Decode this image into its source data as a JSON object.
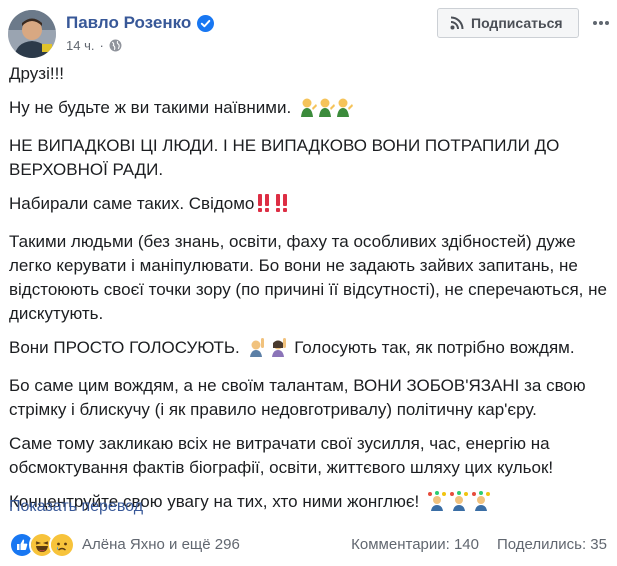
{
  "header": {
    "author": "Павло Розенко",
    "time": "14 ч.",
    "dot": "·",
    "subscribe_label": "Подписаться"
  },
  "post": {
    "paragraphs": [
      "Друзі!!!",
      "Ну не будьте ж ви такими наївними.",
      "НЕ ВИПАДКОВІ ЦІ ЛЮДИ. І НЕ ВИПАДКОВО ВОНИ ПОТРАПИЛИ ДО ВЕРХОВНОЇ РАДИ.",
      "Набирали саме таких. Свідомо",
      "Такими людьми (без знань, освіти, фаху та особливих здібностей) дуже легко керувати і маніпулювати. Бо вони не задають зайвих запитань, не відстоюють своєї точки зору (по причині її відсутності), не сперечаються, не дискутують.",
      "Вони ПРОСТО ГОЛОСУЮТЬ.",
      "Голосують так, як потрібно вождям.",
      "Бо саме цим вождям, а не своїм талантам, ВОНИ ЗОБОВ'ЯЗАНІ за свою стрімку і блискучу (і як правило недовготривалу) політичну кар'єру.",
      "Саме тому закликаю всіх не витрачати свої зусилля, час, енергію на обсмоктування фактів біографії, освіти, життєвого шляху цих кульок!",
      "Концентруйте свою увагу на тих, хто ними жонглює!"
    ]
  },
  "translate_label": "Показать перевод",
  "footer": {
    "reactions_text": "Алёна Яхно и ещё 296",
    "comments": "Комментарии: 140",
    "shares": "Поделились: 35"
  },
  "icons": {
    "verified": "verified-badge-icon",
    "globe": "globe-icon",
    "subscribe": "rss-icon",
    "more": "more-dots-icon",
    "like": "like-icon",
    "haha": "haha-icon",
    "sad": "sad-icon"
  },
  "colors": {
    "link": "#385898",
    "verified": "#1877f2",
    "text": "#1c1e21",
    "muted": "#616770"
  }
}
